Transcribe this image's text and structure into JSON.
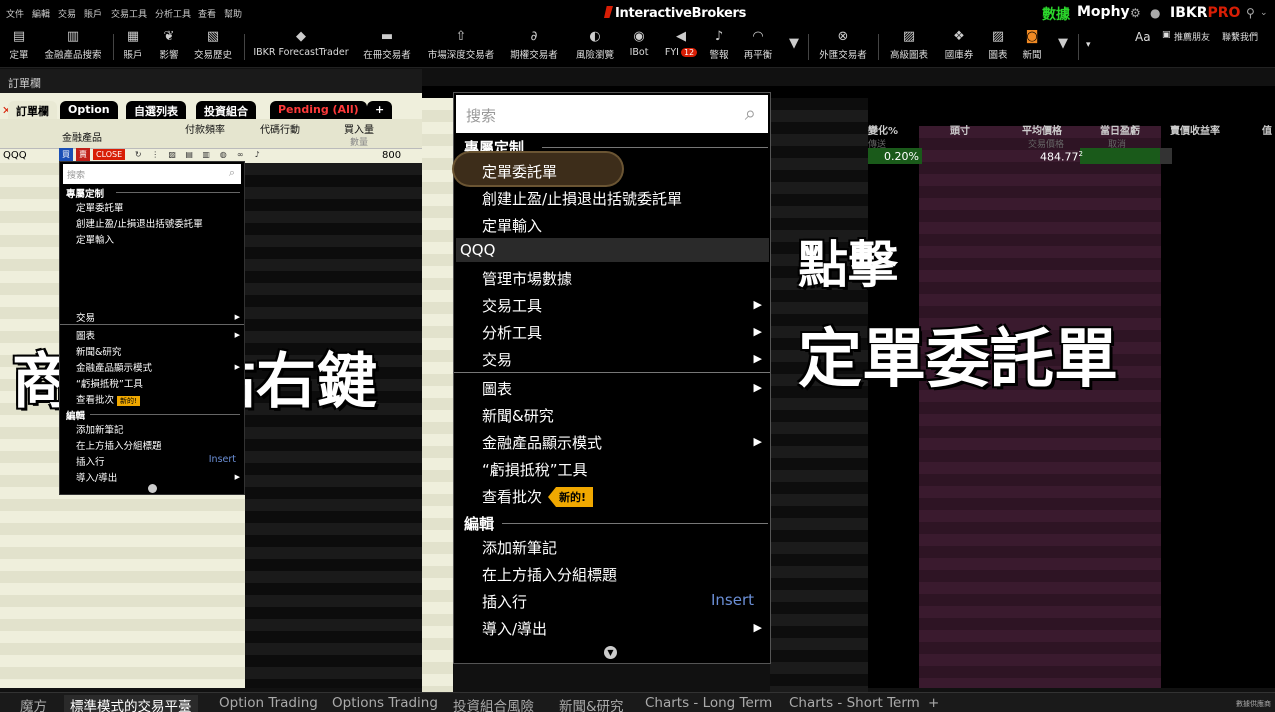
{
  "menubar": {
    "items": [
      "文件",
      "編輯",
      "交易",
      "賬戶",
      "交易工具",
      "分析工具",
      "查看",
      "幫助"
    ],
    "brand": "InteractiveBrokers",
    "data_label": "數據",
    "user": "Mophy",
    "product_name": "IBKR",
    "product_tier": "PRO"
  },
  "toolbar": {
    "items": [
      "定單",
      "金融產品搜索",
      "賬戶",
      "影響",
      "交易歷史",
      "IBKR ForecastTrader",
      "在冊交易者",
      "市場深度交易者",
      "期權交易者",
      "風險瀏覽",
      "IBot",
      "FYI",
      "警報",
      "再平衡",
      "外匯交易者",
      "高級圖表",
      "國庫券",
      "圖表",
      "新聞"
    ],
    "fyi_count": "12",
    "font_label": "Aa",
    "recommend": "推薦朋友",
    "contact": "聯繫我們"
  },
  "panel": {
    "title": "訂單欄",
    "tabs": [
      "訂單欄",
      "Option",
      "自選列表",
      "投資組合",
      "Pending (All)",
      "+"
    ],
    "columns": [
      "金融產品",
      "付款頻率",
      "代碼行動",
      "買入量"
    ],
    "sub_columns": [
      "數量"
    ],
    "row_symbol": "QQQ",
    "row_qty": "800",
    "close_label": "CLOSE"
  },
  "small_menu": {
    "search_placeholder": "搜索",
    "head_custom": "專屬定制",
    "item_order": "定單委託單",
    "item_bracket": "創建止盈/止損退出括號委託單",
    "item_entry": "定單輸入",
    "item_trade": "交易",
    "item_chart": "圖表",
    "item_news": "新聞&研究",
    "item_display": "金融產品顯示模式",
    "item_tax": "“虧損抵稅”工具",
    "item_batch": "查看批次",
    "badge_new": "新的!",
    "head_edit": "編輯",
    "item_note": "添加新筆記",
    "item_group": "在上方插入分組標題",
    "item_insert": "插入行",
    "insert_key": "Insert",
    "item_import": "導入/導出"
  },
  "big_menu": {
    "search_placeholder": "搜索",
    "head_custom": "專屬定制",
    "item_order": "定單委託單",
    "item_bracket": "創建止盈/止損退出括號委託單",
    "item_entry": "定單輸入",
    "symbol": "QQQ",
    "item_market_data": "管理市場數據",
    "item_trade_tools": "交易工具",
    "item_analysis": "分析工具",
    "item_trade": "交易",
    "item_chart": "圖表",
    "item_news": "新聞&研究",
    "item_display": "金融產品顯示模式",
    "item_tax": "“虧損抵稅”工具",
    "item_batch": "查看批次",
    "badge_new": "新的!",
    "head_edit": "編輯",
    "item_note": "添加新筆記",
    "item_group": "在上方插入分組標題",
    "item_insert": "插入行",
    "insert_key": "Insert",
    "item_import": "導入/導出"
  },
  "right": {
    "headers": [
      "變化%",
      "頭寸",
      "平均價格",
      "當日盈虧",
      "賣價收益率",
      "值"
    ],
    "sub_headers": [
      "交易價格",
      "取消",
      "傳送"
    ],
    "pct": "0.20%",
    "avg_price": "484.77",
    "avg_price_sup": "2"
  },
  "overlay": {
    "left": "商品上點右鍵",
    "right_1": "點擊",
    "right_2": "定單委託單"
  },
  "bottom_tabs": [
    "魔方",
    "標準模式的交易平臺",
    "Option Trading",
    "Options Trading",
    "投資組合風險",
    "新聞&研究",
    "Charts - Long Term",
    "Charts - Short Term",
    "+"
  ],
  "bottom_right": "數據供應商",
  "colors": {
    "purple_stripe": "#3a1a2e",
    "purple_stripe_alt": "#2e1424",
    "accent_red": "#d81e05",
    "accent_green": "#2bd62b",
    "badge_orange": "#f0a800"
  }
}
